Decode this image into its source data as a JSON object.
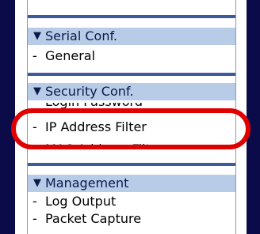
{
  "sections": [
    {
      "title": "Serial Conf.",
      "items": [
        "General"
      ]
    },
    {
      "title": "Security Conf.",
      "items": [
        "Login Password",
        "IP Address Filter",
        "MAC Address Filter"
      ]
    },
    {
      "title": "Management",
      "items": [
        "Log Output",
        "Packet Capture"
      ]
    }
  ],
  "icons": {
    "section_marker": "triangle-down-icon",
    "item_marker": "dash"
  },
  "colors": {
    "rail": "#0b0b4a",
    "section_bg": "#b8cce8",
    "separator": "#3d5aa0",
    "highlight": "#e00000"
  }
}
